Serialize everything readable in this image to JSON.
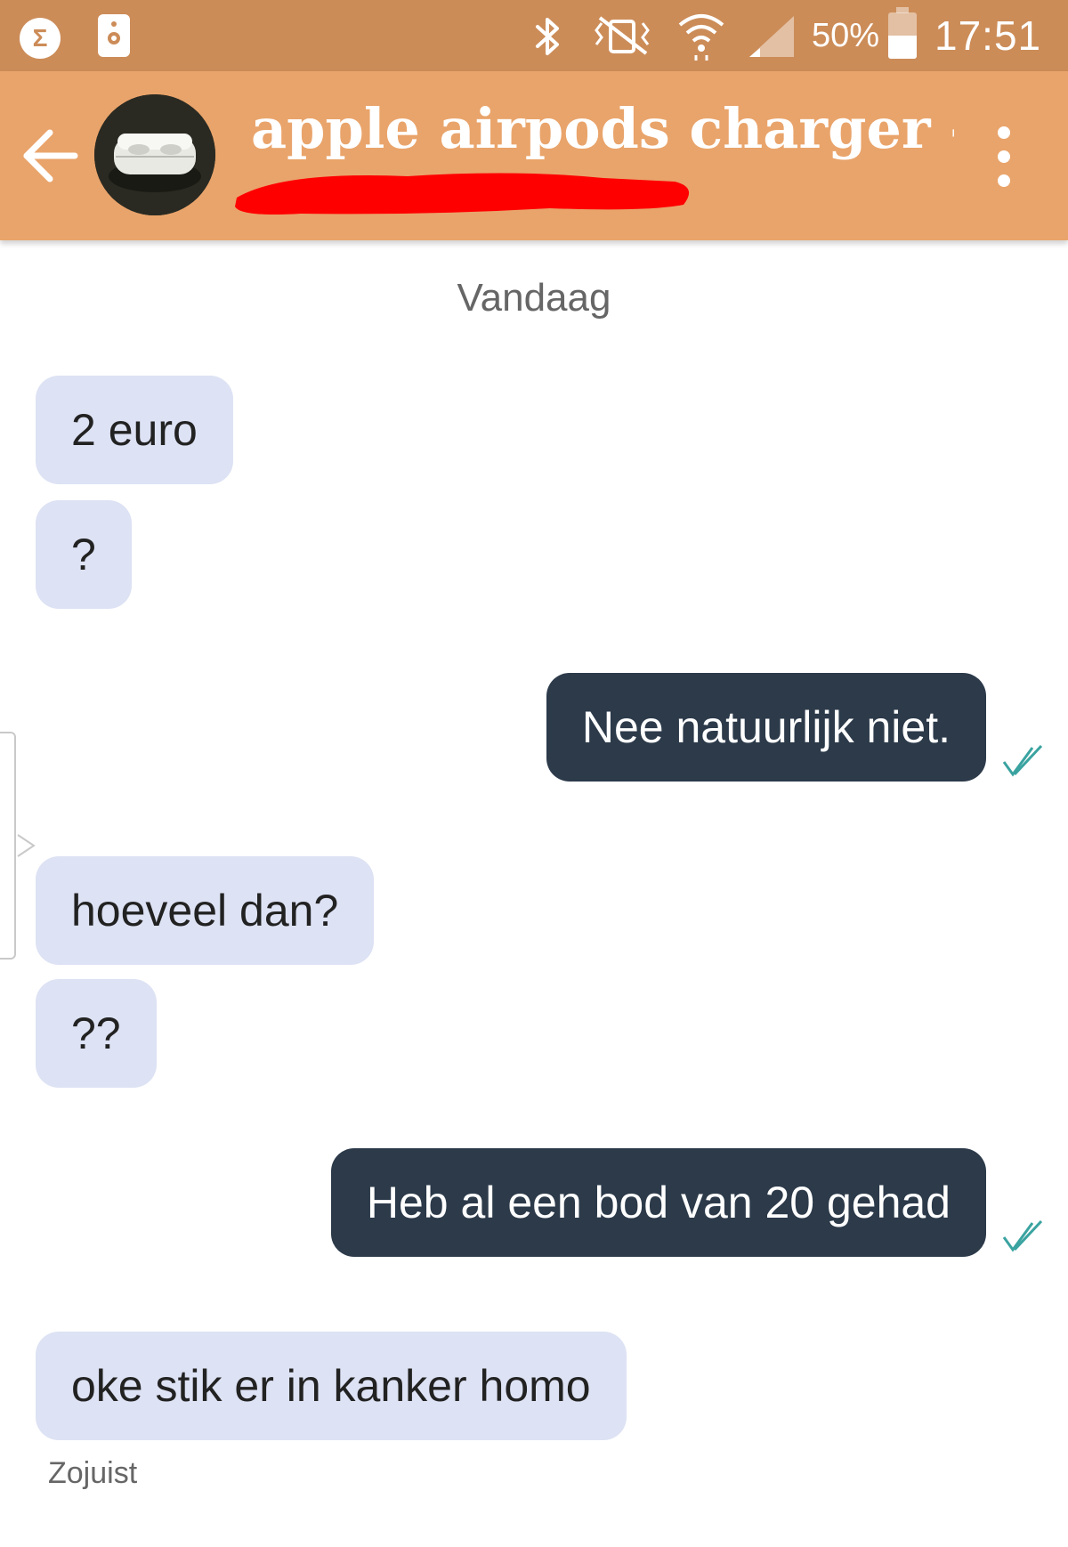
{
  "status_bar": {
    "notification_icon": "sigma-icon",
    "app_icon": "speaker-icon",
    "bluetooth_icon": "bluetooth-icon",
    "vibrate_icon": "vibrate-muted-icon",
    "wifi_icon": "wifi-icon",
    "signal_icon": "signal-icon",
    "battery_level": 0.5,
    "battery_text": "50%",
    "time": "17:51"
  },
  "header": {
    "title": "apple airpods charger -...",
    "back_icon": "arrow-left-icon",
    "avatar_icon": "airpods-case-thumbnail",
    "more_icon": "more-vertical-icon",
    "accent": "#e9a46b",
    "status_bar_color": "#cc8c58",
    "redaction_color": "#ff0000"
  },
  "chat": {
    "date_separator": "Vandaag",
    "messages": [
      {
        "direction": "incoming",
        "text": "2 euro"
      },
      {
        "direction": "incoming",
        "text": "?"
      },
      {
        "direction": "outgoing",
        "text": "Nee natuurlijk niet.",
        "read": true
      },
      {
        "direction": "incoming",
        "text": "hoeveel dan?"
      },
      {
        "direction": "incoming",
        "text": "??"
      },
      {
        "direction": "outgoing",
        "text": "Heb al een bod van 20 gehad",
        "read": true
      },
      {
        "direction": "incoming",
        "text": "oke stik er in kanker homo"
      }
    ],
    "last_timestamp": "Zojuist",
    "incoming_bubble_color": "#dde2f4",
    "outgoing_bubble_color": "#2c3a4a",
    "read_check_color": "#3aa3a0"
  }
}
